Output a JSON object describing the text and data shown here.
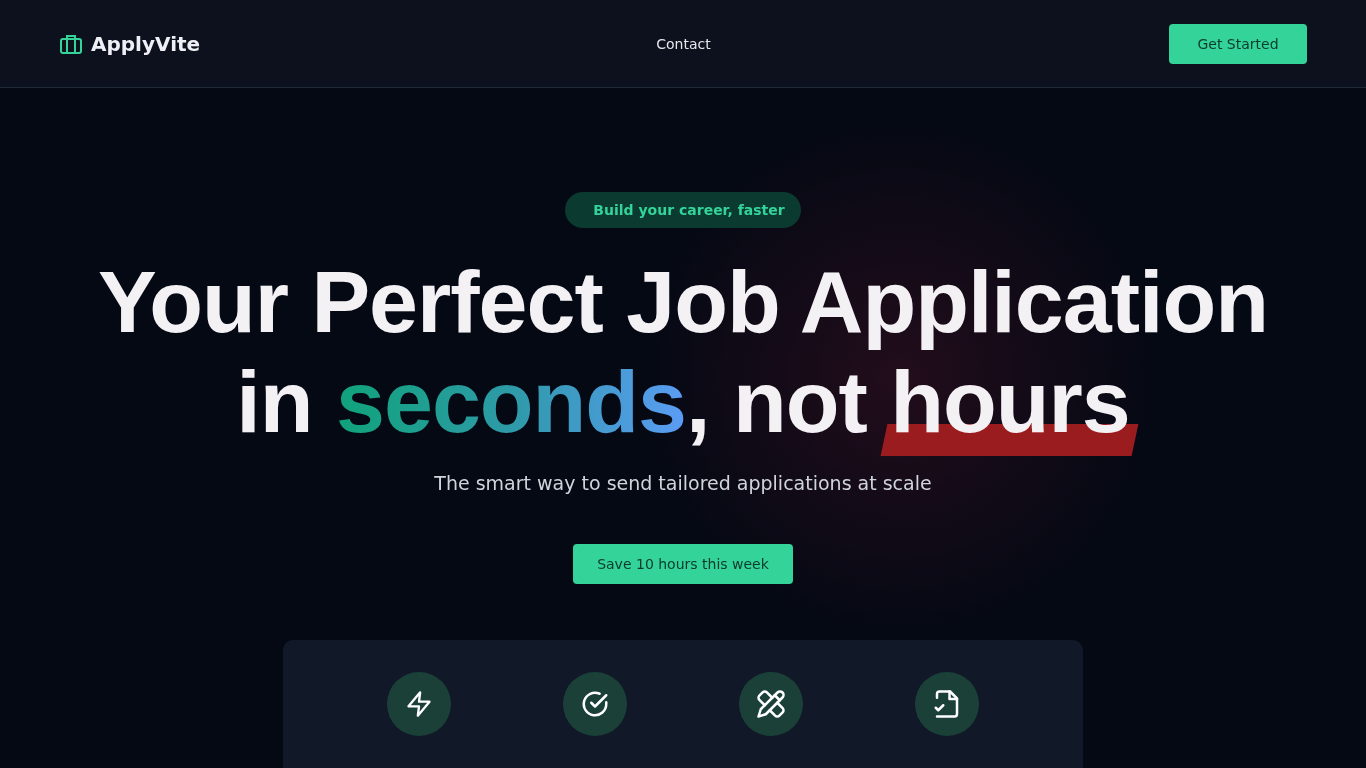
{
  "header": {
    "brand": "ApplyVite",
    "nav": [
      "Contact"
    ],
    "cta": "Get Started"
  },
  "hero": {
    "badge": "Build your career, faster",
    "line1": "Your Perfect Job Application",
    "line2": [
      {
        "text": "in ",
        "kind": "plain"
      },
      {
        "text": "seconds",
        "kind": "gradient"
      },
      {
        "text": ", not ",
        "kind": "plain"
      },
      {
        "text": "hours",
        "kind": "marked"
      }
    ],
    "subtitle": "The smart way to send tailored applications at scale",
    "button": "Save 10 hours this week"
  },
  "features": [
    {
      "kind": "bolt"
    },
    {
      "kind": "check"
    },
    {
      "kind": "tools"
    },
    {
      "kind": "file"
    }
  ]
}
